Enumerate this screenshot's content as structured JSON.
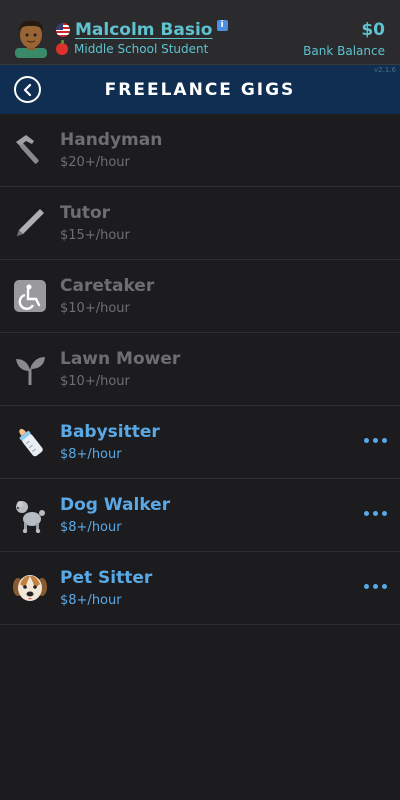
{
  "profile": {
    "name": "Malcolm Basio",
    "role": "Middle School Student",
    "balance": "$0",
    "balance_label": "Bank Balance",
    "version": "v2.1.6"
  },
  "nav": {
    "title": "FREELANCE GIGS"
  },
  "gigs": [
    {
      "title": "Handyman",
      "rate": "$20+/hour",
      "enabled": false,
      "icon": "hammer-icon"
    },
    {
      "title": "Tutor",
      "rate": "$15+/hour",
      "enabled": false,
      "icon": "pencil-icon"
    },
    {
      "title": "Caretaker",
      "rate": "$10+/hour",
      "enabled": false,
      "icon": "wheelchair-icon"
    },
    {
      "title": "Lawn Mower",
      "rate": "$10+/hour",
      "enabled": false,
      "icon": "seedling-icon"
    },
    {
      "title": "Babysitter",
      "rate": "$8+/hour",
      "enabled": true,
      "icon": "baby-bottle-icon"
    },
    {
      "title": "Dog Walker",
      "rate": "$8+/hour",
      "enabled": true,
      "icon": "poodle-icon"
    },
    {
      "title": "Pet Sitter",
      "rate": "$8+/hour",
      "enabled": true,
      "icon": "dog-face-icon"
    }
  ]
}
